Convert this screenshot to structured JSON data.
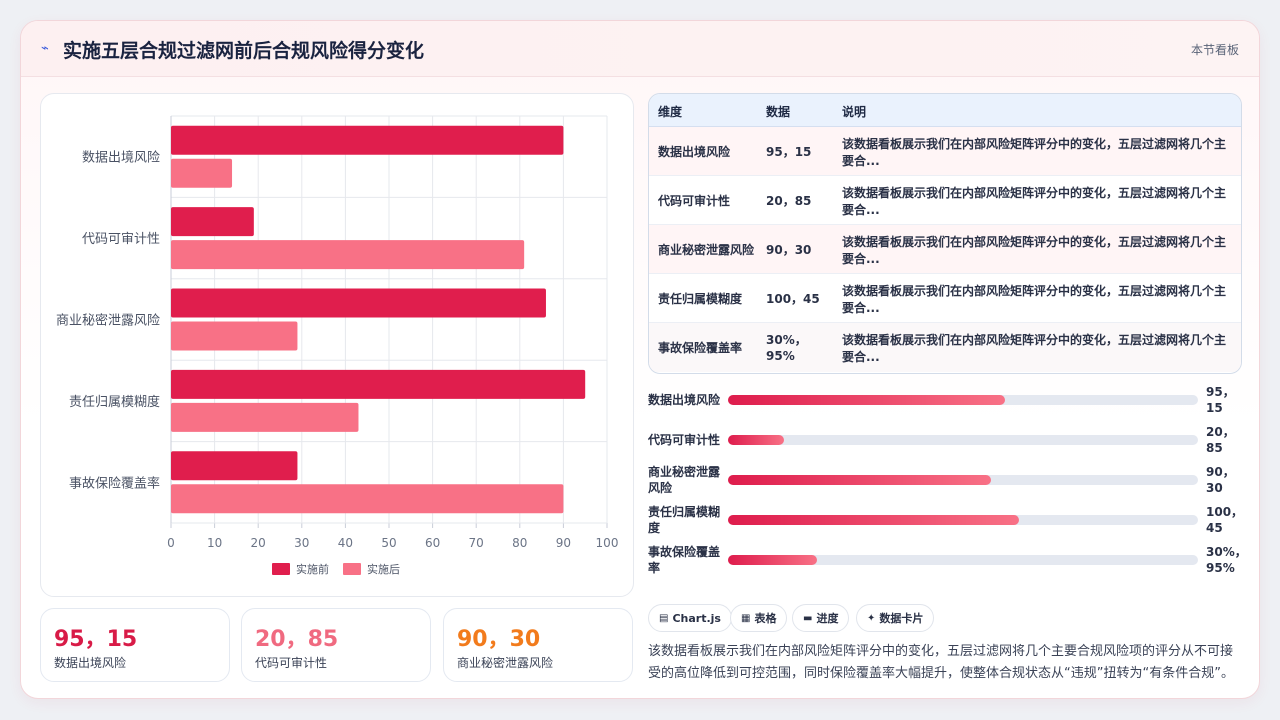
{
  "header": {
    "icon": "sparkline-icon",
    "title": "实施五层合规过滤网前后合规风险得分变化",
    "tag": "本节看板"
  },
  "chart_data": {
    "type": "bar",
    "orientation": "horizontal",
    "categories": [
      "数据出境风险",
      "代码可审计性",
      "商业秘密泄露风险",
      "责任归属模糊度",
      "事故保险覆盖率"
    ],
    "series": [
      {
        "name": "实施前",
        "values": [
          90,
          19,
          86,
          95,
          29
        ],
        "color": "#e01e4d"
      },
      {
        "name": "实施后",
        "values": [
          14,
          81,
          29,
          43,
          90
        ],
        "color": "#f87186"
      }
    ],
    "xlim": [
      0,
      100
    ],
    "xticks": [
      0,
      10,
      20,
      30,
      40,
      50,
      60,
      70,
      80,
      90,
      100
    ],
    "grid": true,
    "legend_position": "bottom"
  },
  "stats": [
    {
      "value": "95，15",
      "label": "数据出境风险",
      "color": "#d81b47"
    },
    {
      "value": "20，85",
      "label": "代码可审计性",
      "color": "#f06a80"
    },
    {
      "value": "90，30",
      "label": "商业秘密泄露风险",
      "color": "#f27b1c"
    }
  ],
  "table": {
    "headers": [
      "维度",
      "数据",
      "说明"
    ],
    "rows": [
      {
        "dim": "数据出境风险",
        "data": "95，15",
        "desc": "该数据看板展示我们在内部风险矩阵评分中的变化，五层过滤网将几个主要合..."
      },
      {
        "dim": "代码可审计性",
        "data": "20，85",
        "desc": "该数据看板展示我们在内部风险矩阵评分中的变化，五层过滤网将几个主要合..."
      },
      {
        "dim": "商业秘密泄露风险",
        "data": "90，30",
        "desc": "该数据看板展示我们在内部风险矩阵评分中的变化，五层过滤网将几个主要合..."
      },
      {
        "dim": "责任归属模糊度",
        "data": "100，45",
        "desc": "该数据看板展示我们在内部风险矩阵评分中的变化，五层过滤网将几个主要合..."
      },
      {
        "dim": "事故保险覆盖率",
        "data": "30%，95%",
        "desc": "该数据看板展示我们在内部风险矩阵评分中的变化，五层过滤网将几个主要合..."
      }
    ]
  },
  "progress": [
    {
      "label": "数据出境风险",
      "value": "95，15",
      "percent": 59
    },
    {
      "label": "代码可审计性",
      "value": "20，85",
      "percent": 12
    },
    {
      "label": "商业秘密泄露风险",
      "value": "90，30",
      "percent": 56
    },
    {
      "label": "责任归属模糊度",
      "value": "100，45",
      "percent": 62
    },
    {
      "label": "事故保险覆盖率",
      "value": "30%，95%",
      "percent": 19
    }
  ],
  "pills": [
    {
      "icon": "chart-icon",
      "glyph": "▤",
      "label": "Chart.js"
    },
    {
      "icon": "table-icon",
      "glyph": "▦",
      "label": "表格"
    },
    {
      "icon": "progress-icon",
      "glyph": "▬",
      "label": "进度"
    },
    {
      "icon": "card-icon",
      "glyph": "✦",
      "label": "数据卡片"
    }
  ],
  "description": "该数据看板展示我们在内部风险矩阵评分中的变化，五层过滤网将几个主要合规风险项的评分从不可接受的高位降低到可控范围，同时保险覆盖率大幅提升，使整体合规状态从“违规”扭转为“有条件合规”。"
}
